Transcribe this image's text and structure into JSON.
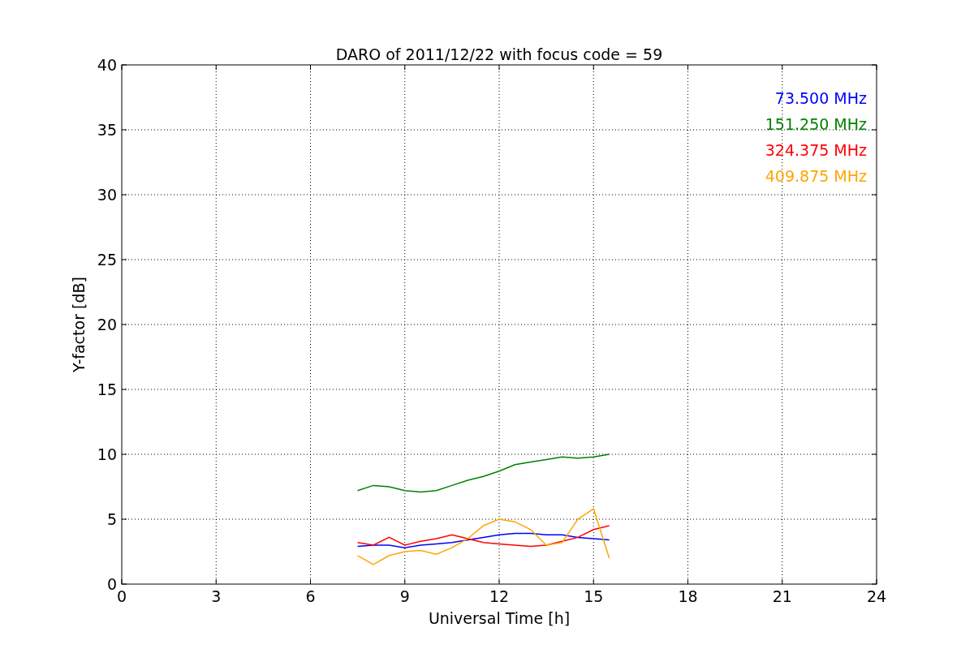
{
  "figure": {
    "chart_data": {
      "type": "line",
      "title": "DARO of 2011/12/22 with focus code = 59",
      "xlabel": "Universal Time [h]",
      "ylabel": "Y-factor [dB]",
      "x": [
        7.5,
        8,
        8.5,
        9,
        9.5,
        10,
        10.5,
        11,
        11.5,
        12,
        12.5,
        13,
        13.5,
        14,
        14.5,
        15,
        15.5
      ],
      "series": [
        {
          "name": "73.500 MHz",
          "color": "#0000ff",
          "values": [
            2.9,
            3.0,
            3.0,
            2.8,
            3.0,
            3.1,
            3.2,
            3.4,
            3.6,
            3.8,
            3.9,
            3.9,
            3.8,
            3.8,
            3.6,
            3.5,
            3.4
          ]
        },
        {
          "name": "151.250 MHz",
          "color": "#008000",
          "values": [
            7.2,
            7.6,
            7.5,
            7.2,
            7.1,
            7.2,
            7.6,
            8.0,
            8.3,
            8.7,
            9.2,
            9.4,
            9.6,
            9.8,
            9.7,
            9.8,
            10.0
          ]
        },
        {
          "name": "324.375 MHz",
          "color": "#ff0000",
          "values": [
            3.2,
            3.0,
            3.6,
            3.0,
            3.3,
            3.5,
            3.8,
            3.5,
            3.2,
            3.1,
            3.0,
            2.9,
            3.0,
            3.3,
            3.6,
            4.2,
            4.5
          ]
        },
        {
          "name": "409.875 MHz",
          "color": "#ffa500",
          "values": [
            2.2,
            1.5,
            2.2,
            2.5,
            2.6,
            2.3,
            2.8,
            3.5,
            4.5,
            5.0,
            4.8,
            4.2,
            3.0,
            3.2,
            5.0,
            5.8,
            2.0
          ]
        }
      ],
      "xlim": [
        0,
        24
      ],
      "ylim": [
        0,
        40
      ],
      "xticks": [
        0,
        3,
        6,
        9,
        12,
        15,
        18,
        21,
        24
      ],
      "yticks": [
        0,
        5,
        10,
        15,
        20,
        25,
        30,
        35,
        40
      ],
      "grid": true
    }
  }
}
